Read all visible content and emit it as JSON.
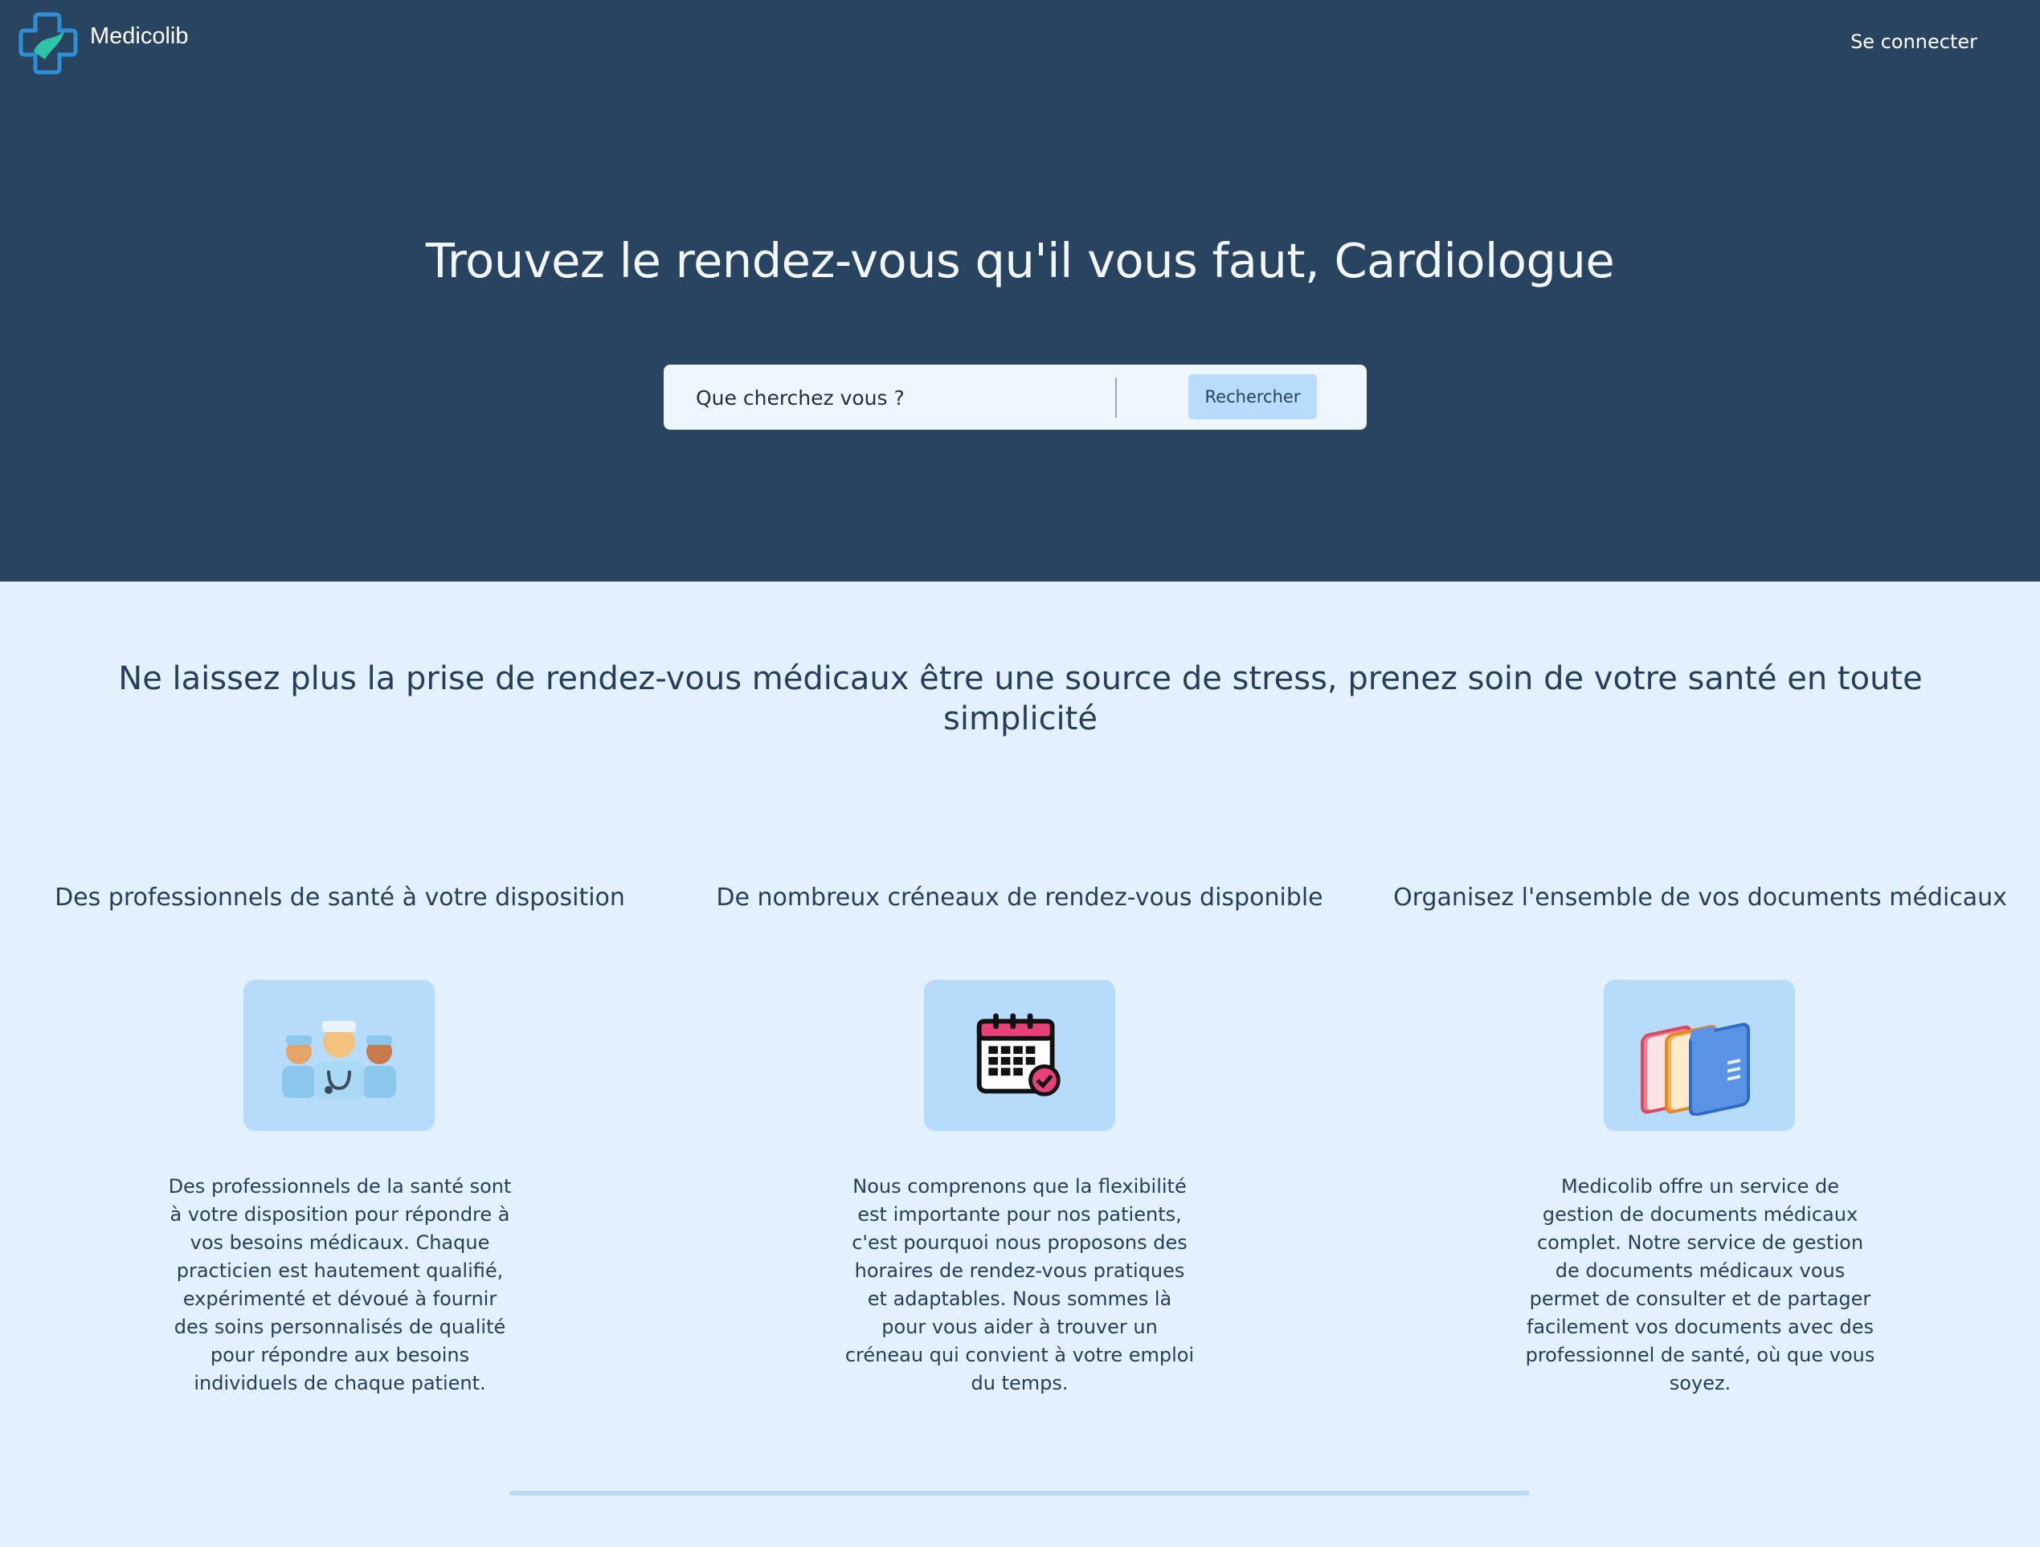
{
  "brand": {
    "name": "Medicolib"
  },
  "header": {
    "login_label": "Se connecter"
  },
  "hero": {
    "title": "Trouvez le rendez-vous qu'il vous faut, Cardiologue"
  },
  "search": {
    "placeholder": "Que cherchez vous ?",
    "button_label": "Rechercher"
  },
  "tagline": "Ne laissez plus la prise de rendez-vous médicaux être une source de stress, prenez soin de votre santé en toute simplicité",
  "features": [
    {
      "title": "Des professionnels de santé à votre disposition",
      "icon": "doctors-icon",
      "text": "Des professionnels de la santé sont à votre disposition pour répondre à vos besoins médicaux. Chaque practicien est hautement qualifié, expérimenté et dévoué à fournir des soins personnalisés de qualité pour répondre aux besoins individuels de chaque patient."
    },
    {
      "title": "De nombreux créneaux de rendez-vous disponible",
      "icon": "calendar-check-icon",
      "text": "Nous comprenons que la flexibilité est importante pour nos patients, c'est pourquoi nous proposons des horaires de rendez-vous pratiques et adaptables. Nous sommes là pour vous aider à trouver un créneau qui convient à votre emploi du temps."
    },
    {
      "title": "Organisez l'ensemble de vos documents médicaux",
      "icon": "folders-icon",
      "text": "Medicolib offre un service de gestion de documents médicaux complet. Notre service de gestion de documents médicaux vous permet de consulter et de partager facilement vos documents avec des professionnel de santé, où que vous soyez."
    }
  ],
  "colors": {
    "hero_bg": "#284461",
    "page_bg": "#e3f0fd",
    "accent_light": "#b6dbfb",
    "text_dark": "#263e5c"
  }
}
